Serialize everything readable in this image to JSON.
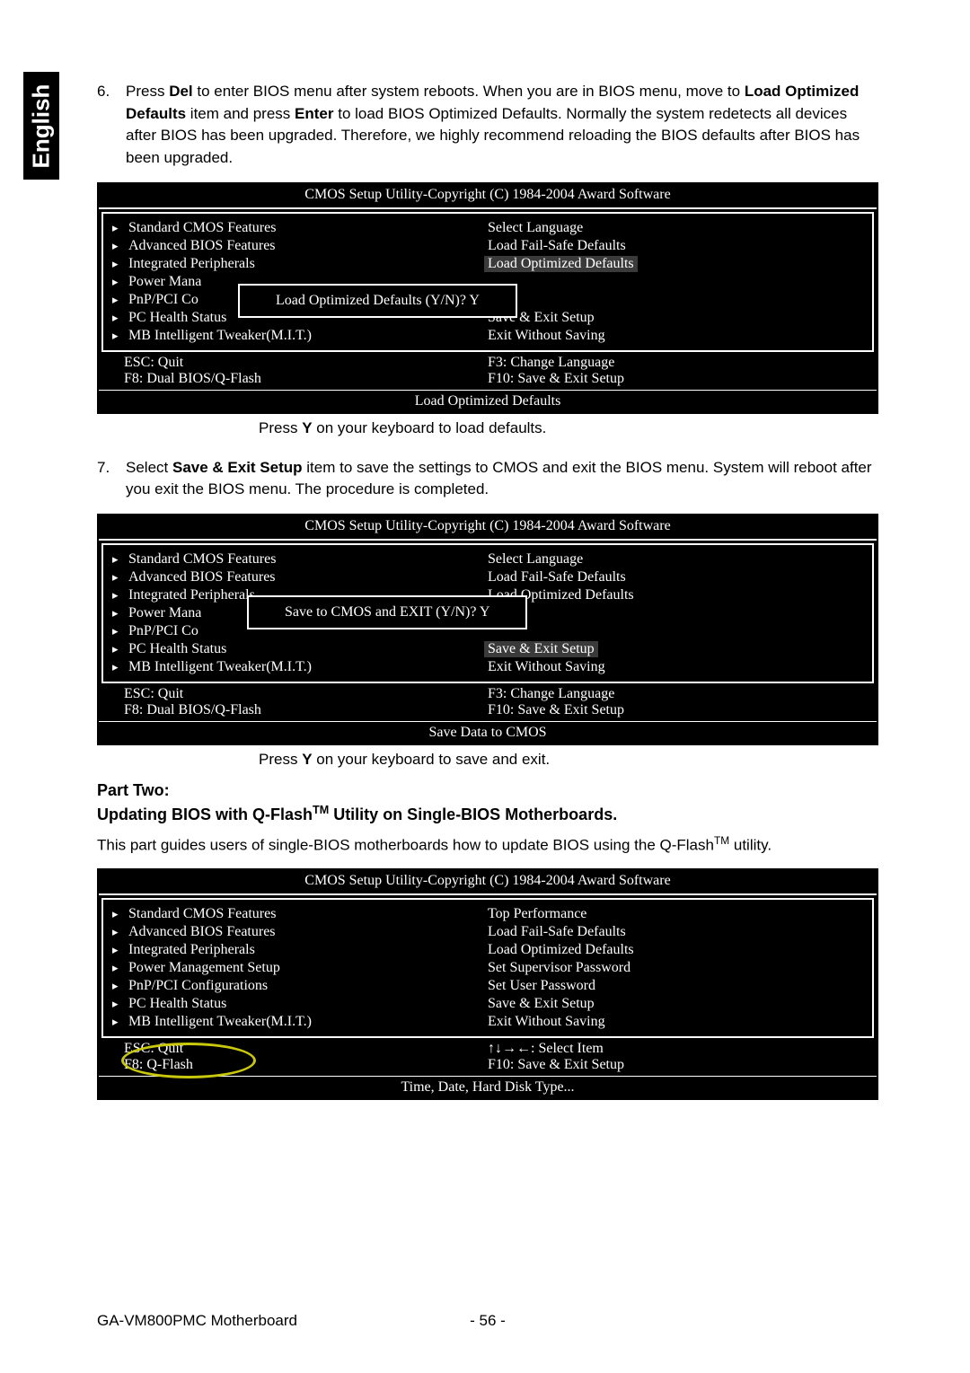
{
  "sideTab": "English",
  "step6": {
    "num": "6",
    "text_parts": {
      "p1": "Press ",
      "b1": "Del",
      "p2": " to enter BIOS menu after system reboots. When you are in BIOS menu, move to ",
      "b2": "Load Optimized Defaults",
      "p3": " item and press ",
      "b3": "Enter",
      "p4": " to load BIOS Optimized Defaults. Normally the system redetects all devices after BIOS has been upgraded. Therefore, we highly recommend reloading the BIOS defaults after BIOS has been upgraded."
    }
  },
  "step7": {
    "num": "7",
    "text_parts": {
      "p1": "Select ",
      "b1": "Save & Exit Setup",
      "p2": " item to save the settings to CMOS and exit the BIOS menu. System will reboot after you exit the BIOS menu. The procedure is completed."
    }
  },
  "bios_shared": {
    "title": "CMOS Setup Utility-Copyright (C) 1984-2004 Award Software",
    "left_items": [
      "Standard CMOS Features",
      "Advanced BIOS Features",
      "Integrated Peripherals",
      "Power Management Setup",
      "PnP/PCI Configurations",
      "PC Health Status",
      "MB Intelligent Tweaker(M.I.T.)"
    ],
    "left_items_trunc": [
      "Standard CMOS Features",
      "Advanced BIOS Features",
      "Integrated Peripherals",
      "Power Mana",
      "PnP/PCI Co",
      "PC Health Status",
      "MB Intelligent Tweaker(M.I.T.)"
    ],
    "right_items_a": [
      "Select Language",
      "Load Fail-Safe Defaults",
      "Load Optimized Defaults",
      "",
      "",
      "Save & Exit Setup",
      "Exit Without Saving"
    ],
    "foot": {
      "esc": "ESC: Quit",
      "f3": "F3: Change Language",
      "f8_dual": "F8: Dual BIOS/Q-Flash",
      "f8_single": "F8: Q-Flash",
      "f10": "F10: Save & Exit Setup",
      "arrows": "↑↓→←: Select Item"
    }
  },
  "bios1": {
    "dialog": "Load Optimized Defaults (Y/N)? Y",
    "highlight_idx": 2,
    "footer_text": "Load Optimized Defaults",
    "caption_p1": "Press ",
    "caption_b": "Y",
    "caption_p2": " on your keyboard to load defaults."
  },
  "bios2": {
    "dialog": "Save to CMOS and EXIT (Y/N)? Y",
    "highlight_idx": 5,
    "footer_text": "Save Data to CMOS",
    "caption_p1": "Press ",
    "caption_b": "Y",
    "caption_p2": " on your keyboard to save and exit."
  },
  "partTwo": {
    "heading": "Part Two:",
    "sub_p1": "Updating BIOS with Q-Flash",
    "sub_p2": " Utility on Single-BIOS Motherboards.",
    "body_p1": "This part guides users of single-BIOS motherboards how to update BIOS using the Q-Flash",
    "body_p2": " utility."
  },
  "bios3": {
    "right_items": [
      "Top Performance",
      "Load Fail-Safe Defaults",
      "Load Optimized Defaults",
      "Set Supervisor Password",
      "Set User Password",
      "Save & Exit Setup",
      "Exit Without Saving"
    ],
    "footer_text": "Time, Date, Hard Disk Type..."
  },
  "pageFooter": {
    "model": "GA-VM800PMC Motherboard",
    "page": "- 56 -"
  }
}
